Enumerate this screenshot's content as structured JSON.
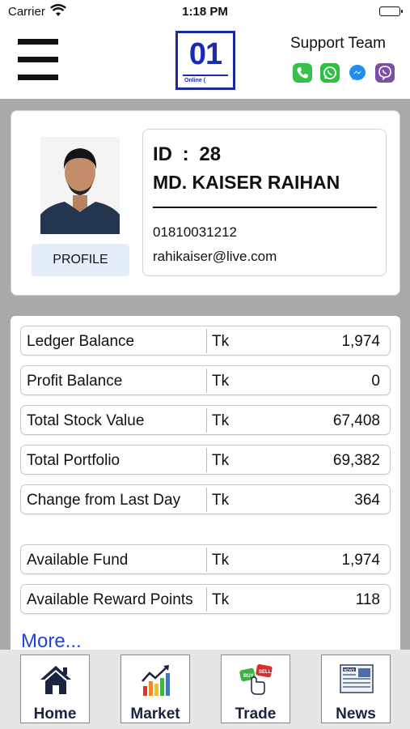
{
  "status_bar": {
    "carrier": "Carrier",
    "time": "1:18 PM"
  },
  "header": {
    "logo_number": "01",
    "logo_sub": "Online (",
    "support_title": "Support Team",
    "support_icons": [
      "phone-icon",
      "whatsapp-icon",
      "messenger-icon",
      "viber-icon"
    ],
    "brand_color": "#1a2bb3"
  },
  "profile": {
    "id_label": "ID",
    "id_sep": ":",
    "id_value": "28",
    "name": "MD. KAISER RAIHAN",
    "phone": "01810031212",
    "email": "rahikaiser@live.com",
    "profile_button": "PROFILE"
  },
  "balances": {
    "rows": [
      {
        "label": "Ledger Balance",
        "currency": "Tk",
        "value": "1,974"
      },
      {
        "label": "Profit Balance",
        "currency": "Tk",
        "value": "0"
      },
      {
        "label": "Total Stock Value",
        "currency": "Tk",
        "value": "67,408"
      },
      {
        "label": "Total Portfolio",
        "currency": "Tk",
        "value": "69,382"
      },
      {
        "label": "Change from Last Day",
        "currency": "Tk",
        "value": "364"
      },
      {
        "label": "Available Fund",
        "currency": "Tk",
        "value": "1,974"
      },
      {
        "label": "Available Reward Points",
        "currency": "Tk",
        "value": "118"
      }
    ],
    "more_link": "More..."
  },
  "bottom_nav": [
    {
      "label": "Home",
      "icon": "home-icon"
    },
    {
      "label": "Market",
      "icon": "market-chart-icon"
    },
    {
      "label": "Trade",
      "icon": "buy-sell-icon"
    },
    {
      "label": "News",
      "icon": "newspaper-icon"
    }
  ]
}
